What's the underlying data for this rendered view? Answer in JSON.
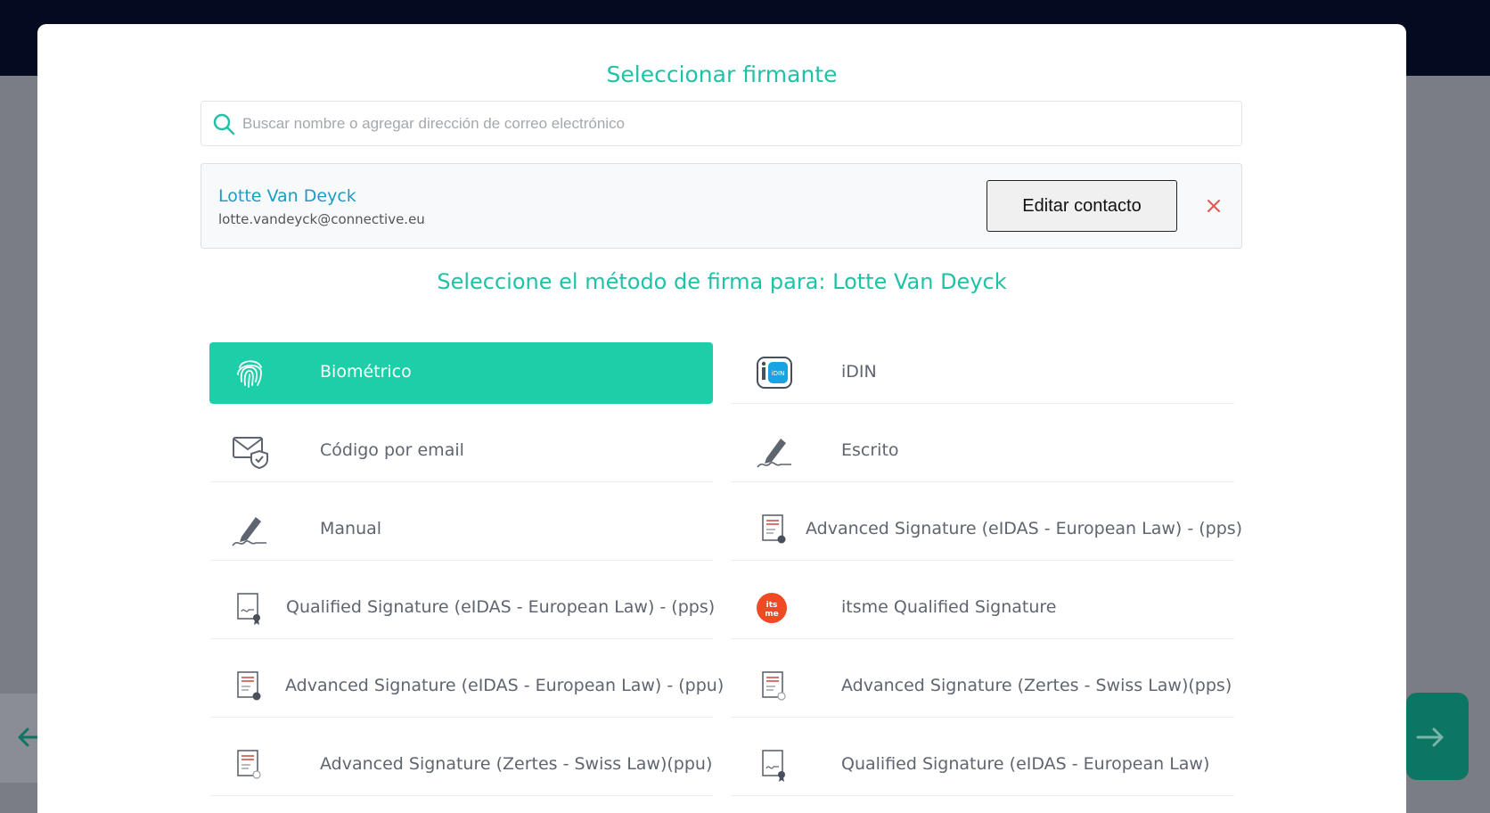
{
  "modal": {
    "title": "Seleccionar firmante",
    "search": {
      "placeholder": "Buscar nombre o agregar dirección de correo electrónico",
      "value": ""
    },
    "contact": {
      "name": "Lotte Van Deyck",
      "email": "lotte.vandeyck@connective.eu",
      "edit_label": "Editar contacto"
    },
    "subtitle": "Seleccione el método de firma para: Lotte Van Deyck"
  },
  "methods": [
    {
      "label": "Biométrico",
      "icon": "fingerprint-icon",
      "selected": true
    },
    {
      "label": "iDIN",
      "icon": "idin-icon",
      "selected": false
    },
    {
      "label": "Código por email",
      "icon": "email-shield-icon",
      "selected": false
    },
    {
      "label": "Escrito",
      "icon": "pen-signature-icon",
      "selected": false
    },
    {
      "label": "Manual",
      "icon": "pen-signature-icon",
      "selected": false
    },
    {
      "label": "Advanced Signature (eIDAS - European Law) - (pps)",
      "icon": "certificate-document-icon",
      "selected": false
    },
    {
      "label": "Qualified Signature (eIDAS - European Law) - (pps)",
      "icon": "signed-document-icon",
      "selected": false
    },
    {
      "label": "itsme Qualified Signature",
      "icon": "itsme-icon",
      "selected": false
    },
    {
      "label": "Advanced Signature (eIDAS - European Law) - (ppu)",
      "icon": "certificate-document-icon",
      "selected": false
    },
    {
      "label": "Advanced Signature (Zertes - Swiss Law)(pps)",
      "icon": "certificate-document-icon",
      "selected": false
    },
    {
      "label": "Advanced Signature (Zertes - Swiss Law)(ppu)",
      "icon": "certificate-document-icon",
      "selected": false
    },
    {
      "label": "Qualified Signature (eIDAS - European Law)",
      "icon": "signed-document-icon",
      "selected": false
    }
  ],
  "colors": {
    "accent": "#1ccfa9",
    "title": "#1fc2a6",
    "name_link": "#1a9dc2",
    "remove": "#e0574f"
  }
}
